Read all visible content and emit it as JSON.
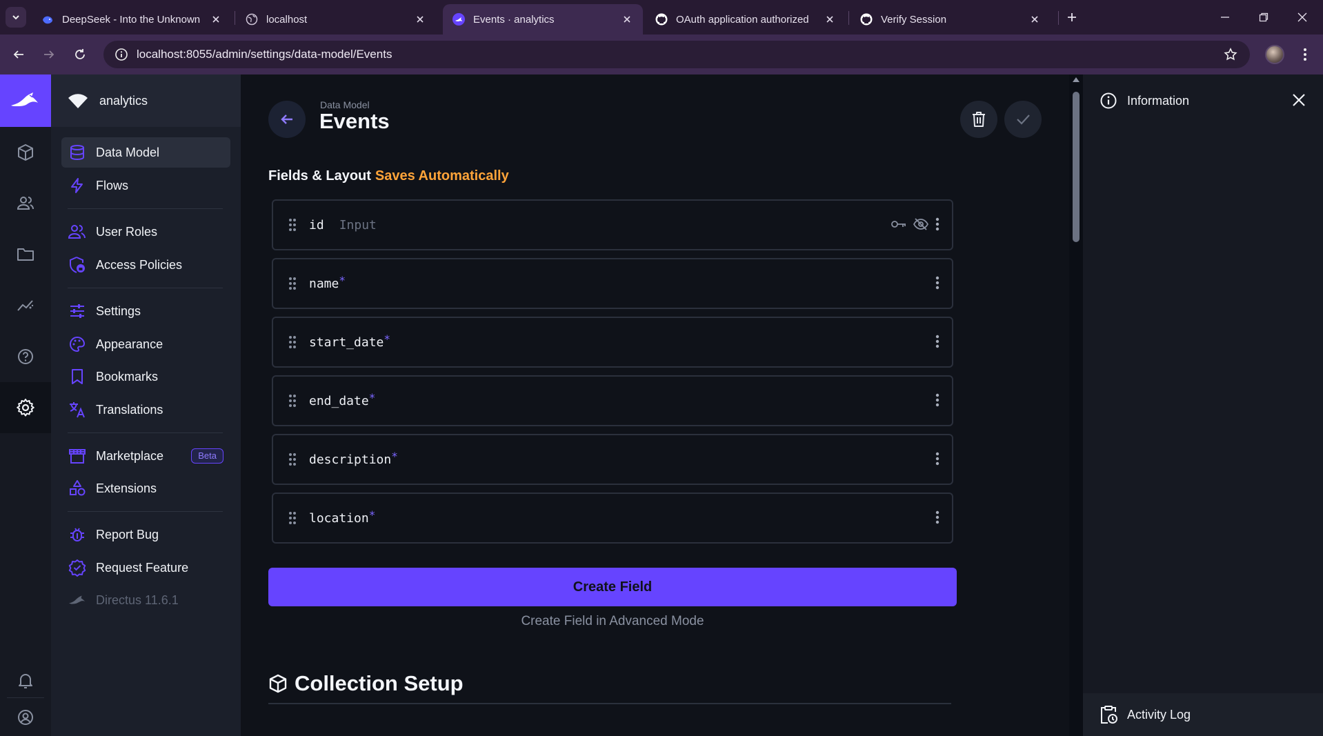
{
  "browser": {
    "tabs": [
      {
        "title": "DeepSeek - Into the Unknown",
        "icon": "deepseek-whale-icon"
      },
      {
        "title": "localhost",
        "icon": "globe-icon"
      },
      {
        "title": "Events · analytics",
        "icon": "directus-rabbit-icon",
        "active": true
      },
      {
        "title": "OAuth application authorized",
        "icon": "github-icon"
      },
      {
        "title": "Verify Session",
        "icon": "github-icon"
      }
    ],
    "url": "localhost:8055/admin/settings/data-model/Events"
  },
  "app": {
    "project_name": "analytics",
    "modules": [
      "content",
      "user-directory",
      "files",
      "insights",
      "help",
      "settings",
      "notifications",
      "user-profile"
    ],
    "nav": {
      "data_model": "Data Model",
      "flows": "Flows",
      "user_roles": "User Roles",
      "access_policies": "Access Policies",
      "settings": "Settings",
      "appearance": "Appearance",
      "bookmarks": "Bookmarks",
      "translations": "Translations",
      "marketplace": "Marketplace",
      "beta": "Beta",
      "extensions": "Extensions",
      "report_bug": "Report Bug",
      "request_feature": "Request Feature",
      "version": "Directus 11.6.1"
    },
    "accent": "#6644ff",
    "warning": "#ffa439"
  },
  "header": {
    "breadcrumb": "Data Model",
    "title": "Events"
  },
  "fields": {
    "heading": "Fields & Layout",
    "saves_note": "Saves Automatically",
    "rows": [
      {
        "name": "id",
        "type": "Input",
        "required": ""
      },
      {
        "name": "name",
        "required": "*"
      },
      {
        "name": "start_date",
        "required": "*"
      },
      {
        "name": "end_date",
        "required": "*"
      },
      {
        "name": "description",
        "required": "*"
      },
      {
        "name": "location",
        "required": "*"
      }
    ],
    "create_button": "Create Field",
    "advanced_link": "Create Field in Advanced Mode"
  },
  "collection_setup": {
    "title": "Collection Setup"
  },
  "sidebar": {
    "information": "Information",
    "activity_log": "Activity Log"
  }
}
